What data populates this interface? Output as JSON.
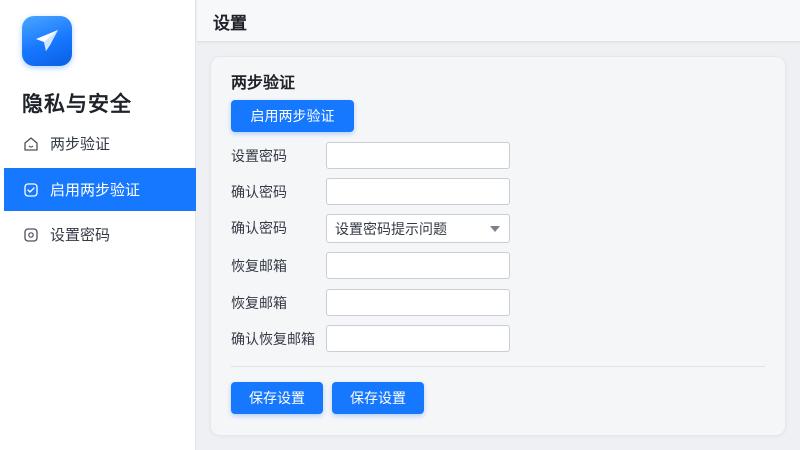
{
  "app": {
    "logo_icon": "paper-plane-icon",
    "brand_color": "#1677ff"
  },
  "sidebar": {
    "title": "隐私与安全",
    "items": [
      {
        "label": "两步验证",
        "icon": "shield-outline-icon",
        "active": false
      },
      {
        "label": "启用两步验证",
        "icon": "checkbox-icon",
        "active": true
      },
      {
        "label": "设置密码",
        "icon": "lock-square-icon",
        "active": false
      }
    ]
  },
  "header": {
    "title": "设置"
  },
  "main": {
    "section_title": "两步验证",
    "enable_button_label": "启用两步验证",
    "fields": [
      {
        "label": "设置密码",
        "type": "input",
        "value": "",
        "placeholder": ""
      },
      {
        "label": "确认密码",
        "type": "input",
        "value": "",
        "placeholder": ""
      },
      {
        "label": "确认密码",
        "type": "select",
        "selected": "设置密码提示问题"
      },
      {
        "label": "恢复邮箱",
        "type": "input",
        "value": "",
        "placeholder": ""
      },
      {
        "label": "恢复邮箱",
        "type": "input",
        "value": "",
        "placeholder": ""
      },
      {
        "label": "确认恢复邮箱",
        "type": "input",
        "value": "",
        "placeholder": ""
      }
    ],
    "buttons": [
      {
        "label": "保存设置"
      },
      {
        "label": "保存设置"
      }
    ]
  }
}
